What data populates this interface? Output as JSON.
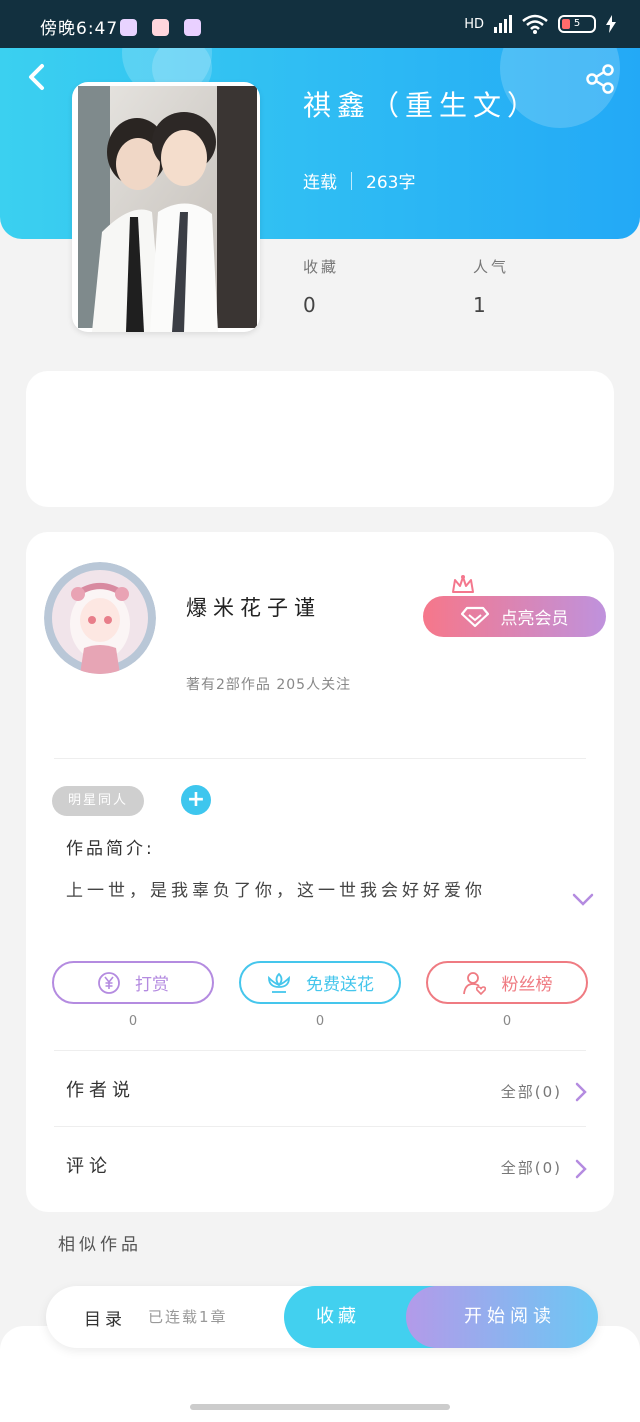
{
  "status_bar": {
    "time": "傍晚6:47",
    "network": "HD",
    "battery": "5"
  },
  "book": {
    "title": "祺鑫（重生文）",
    "status": "连载",
    "word_count": "263字"
  },
  "stats": {
    "favorites_label": "收藏",
    "favorites_value": "0",
    "popularity_label": "人气",
    "popularity_value": "1"
  },
  "author": {
    "name": "爆米花子谨",
    "meta": "著有2部作品 205人关注",
    "vip_button": "点亮会员"
  },
  "tag": "明星同人",
  "intro": {
    "label": "作品简介:",
    "text": "上一世，是我辜负了你，这一世我会好好爱你"
  },
  "actions": [
    {
      "label": "打赏",
      "count": "0",
      "color": "#b48be0"
    },
    {
      "label": "免费送花",
      "count": "0",
      "color": "#45c6ec"
    },
    {
      "label": "粉丝榜",
      "count": "0",
      "color": "#ef7b82"
    }
  ],
  "rows": {
    "author_says_label": "作者说",
    "author_says_value": "全部(0)",
    "comments_label": "评论",
    "comments_value": "全部(0)"
  },
  "similar_label": "相似作品",
  "bottom_bar": {
    "toc": "目录",
    "chapters": "已连载1章",
    "collect": "收藏",
    "read": "开始阅读"
  },
  "colors": {
    "header_gradient_start": "#3bd0f0",
    "header_gradient_end": "#23a9f6",
    "accent_blue": "#42d0ef",
    "vip_pink": "#f6778a",
    "vip_purple": "#bf92dd"
  }
}
